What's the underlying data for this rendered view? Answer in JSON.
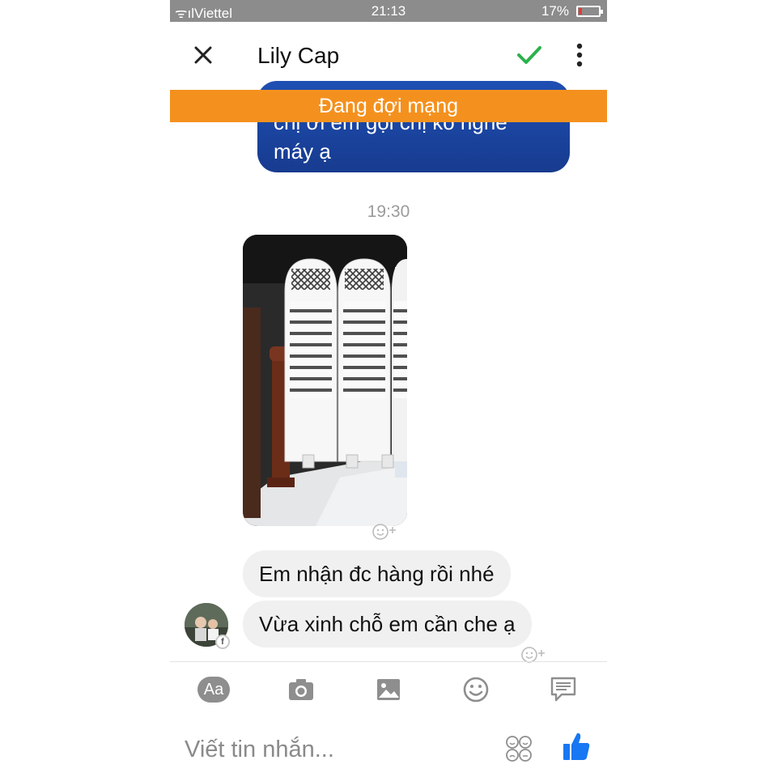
{
  "status_bar": {
    "carrier": "Viettel",
    "time": "21:13",
    "battery": "17%",
    "battery_level": 0.17
  },
  "header": {
    "contact_name": "Lily Cap",
    "icons": [
      "close-icon",
      "check-icon",
      "more-vertical-icon"
    ]
  },
  "banner": {
    "text": "Đang đợi mạng",
    "color": "#f4911e"
  },
  "messages": {
    "outgoing": {
      "line1": "chị ơi  em gọi chị ko nghe",
      "line2": "máy ạ"
    },
    "timestamp": "19:30",
    "incoming": [
      {
        "text": "Em nhận đc hàng rồi nhé"
      },
      {
        "text": "Vừa xinh chỗ em cần che ạ"
      }
    ]
  },
  "toolbar": {
    "aa_label": "Aa",
    "icons": [
      "camera-icon",
      "image-icon",
      "emoji-icon",
      "chat-icon"
    ]
  },
  "composer": {
    "placeholder": "Viết tin nhắn...",
    "like_color": "#1877f2"
  },
  "colors": {
    "outgoing_bubble": "#1f4fb3",
    "incoming_bubble": "#f0f0f0",
    "check": "#2bb24c"
  }
}
